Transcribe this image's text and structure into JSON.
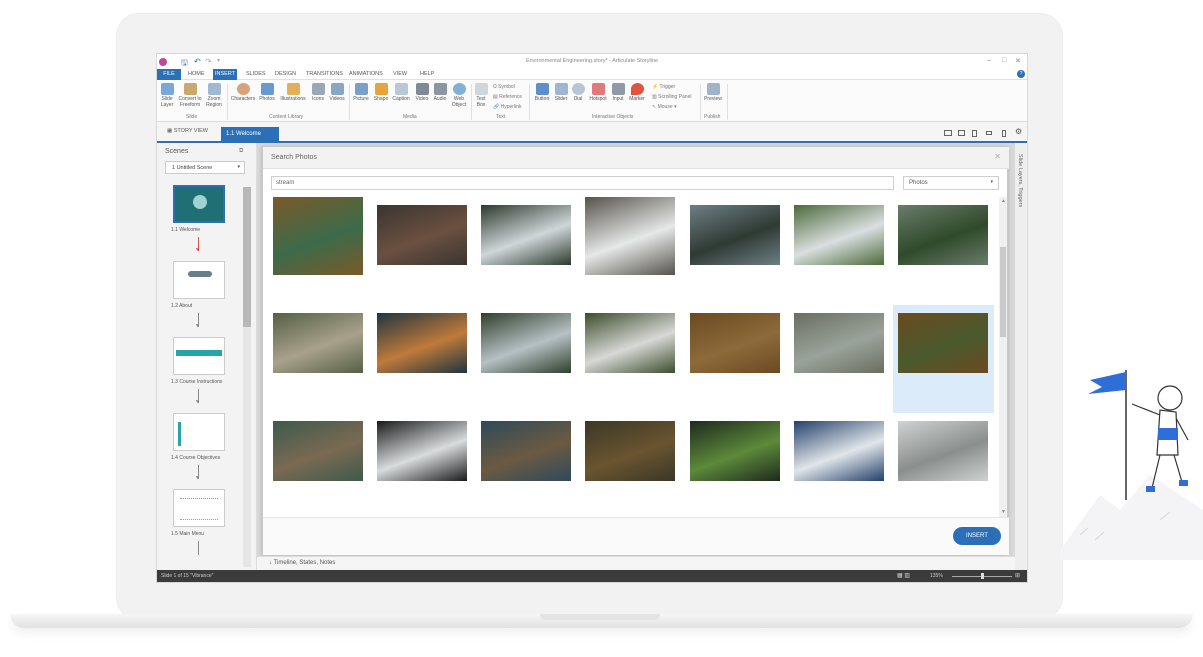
{
  "window": {
    "title": "Environmental Engineering.story* - Articulate Storyline"
  },
  "menu": {
    "file": "FILE",
    "home": "HOME",
    "insert": "INSERT",
    "slides": "SLIDES",
    "design": "DESIGN",
    "transitions": "TRANSITIONS",
    "animations": "ANIMATIONS",
    "view": "VIEW",
    "help": "HELP"
  },
  "ribbon": {
    "slide_layer": "Slide Layer",
    "convert_freeform": "Convert to Freeform",
    "zoom_region": "Zoom Region",
    "characters": "Characters",
    "photos": "Photos",
    "illustrations": "Illustrations",
    "icons": "Icons",
    "videos": "Videos",
    "picture": "Picture",
    "shape": "Shape",
    "caption": "Caption",
    "video": "Video",
    "audio": "Audio",
    "web_object": "Web Object",
    "text_box": "Text Box",
    "symbol": "Symbol",
    "reference": "Reference",
    "hyperlink": "Hyperlink",
    "button": "Button",
    "slider": "Slider",
    "dial": "Dial",
    "hotspot": "Hotspot",
    "input": "Input",
    "marker": "Marker",
    "trigger": "Trigger",
    "scrolling_panel": "Scrolling Panel",
    "mouse": "Mouse",
    "preview": "Preview",
    "groups": {
      "slide": "Slide",
      "content_library": "Content Library",
      "media": "Media",
      "text": "Text",
      "interactive_objects": "Interactive Objects",
      "publish": "Publish"
    }
  },
  "tabs": {
    "story_view": "STORY VIEW",
    "active": "1.1 Welcome"
  },
  "scenes": {
    "title": "Scenes",
    "selected_scene": "1 Untitled Scene",
    "slides": [
      {
        "label": "1.1 Welcome"
      },
      {
        "label": "1.2 About"
      },
      {
        "label": "1.3 Course Instructions"
      },
      {
        "label": "1.4 Course Objectives"
      },
      {
        "label": "1.5 Main Menu"
      }
    ]
  },
  "right_panel": {
    "label": "Slide Layers, Triggers"
  },
  "dialog": {
    "title": "Search Photos",
    "search_value": "stream",
    "type_value": "Photos",
    "insert_label": "INSERT",
    "selected_index": 13,
    "photo_colors": [
      [
        "#7a5a2a",
        "#3c6b4a"
      ],
      [
        "#3a3530",
        "#6b5040"
      ],
      [
        "#2d3a2e",
        "#cfd6d8"
      ],
      [
        "#55524c",
        "#e6e8e8"
      ],
      [
        "#6d7f84",
        "#2f3a34"
      ],
      [
        "#4c6a3a",
        "#d9dfe0"
      ],
      [
        "#6a7c6a",
        "#2f4a2a"
      ],
      [
        "#546044",
        "#a9a18c"
      ],
      [
        "#1f3540",
        "#c07a3a"
      ],
      [
        "#2f3f2c",
        "#b7c1c4"
      ],
      [
        "#3c4e2c",
        "#d8d8d6"
      ],
      [
        "#6b4a22",
        "#8c6a3a"
      ],
      [
        "#6a6e60",
        "#9aa39a"
      ],
      [
        "#6b4a22",
        "#4a5a2c"
      ],
      [
        "#3e5a4c",
        "#7a6a52"
      ],
      [
        "#1a1a1a",
        "#d9dcde"
      ],
      [
        "#2e4a5a",
        "#6b5a42"
      ],
      [
        "#3a3826",
        "#6a5430"
      ],
      [
        "#1e2a1e",
        "#5c8a3a"
      ],
      [
        "#24406a",
        "#e0e6ea"
      ],
      [
        "#cfd2d2",
        "#8a8e8c"
      ]
    ]
  },
  "timeline": {
    "label": "Timeline, States, Notes"
  },
  "status": {
    "slide_info": "Slide 1 of 15   \"Vibrance\"",
    "zoom": "135%"
  }
}
